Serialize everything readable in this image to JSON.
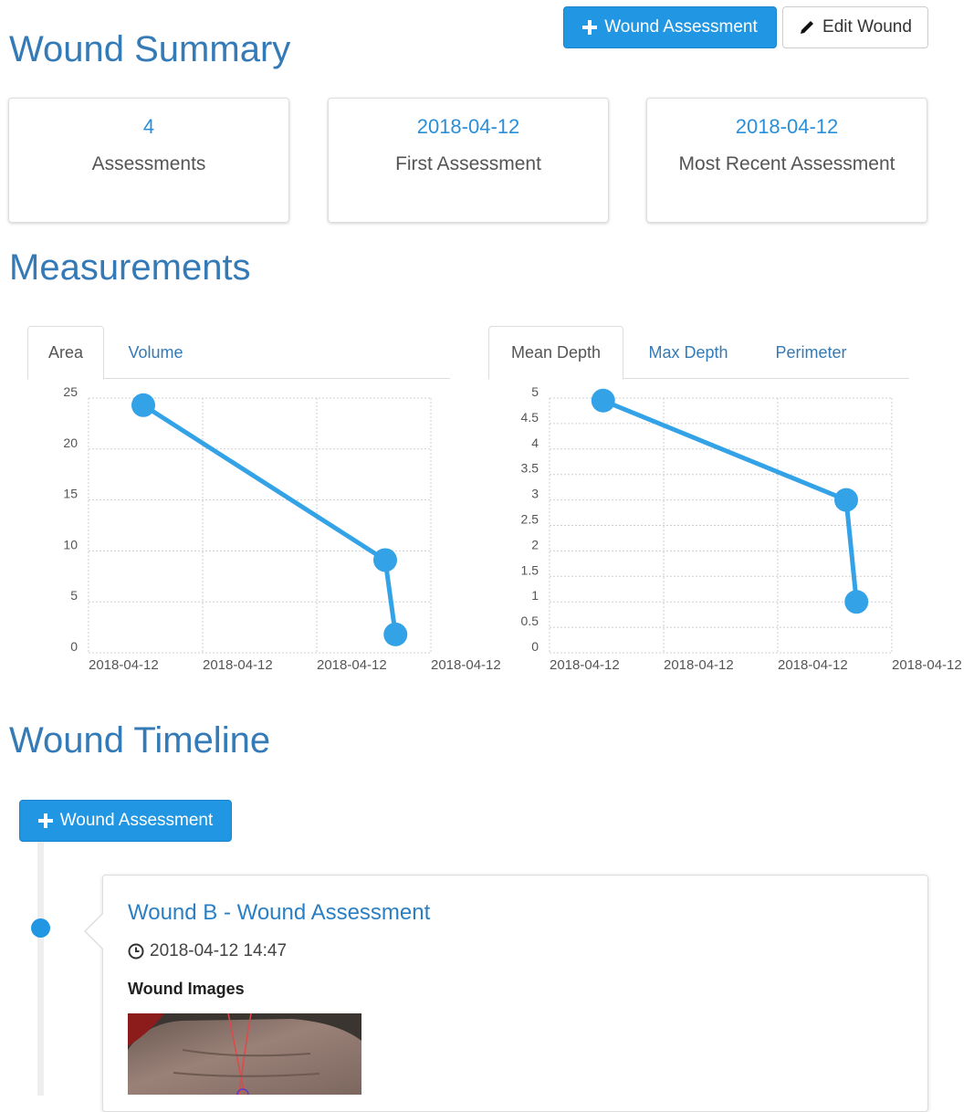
{
  "header": {
    "title": "Wound Summary",
    "add_assessment_label": "Wound Assessment",
    "edit_wound_label": "Edit Wound"
  },
  "summary_cards": [
    {
      "value": "4",
      "label": "Assessments"
    },
    {
      "value": "2018-04-12",
      "label": "First Assessment"
    },
    {
      "value": "2018-04-12",
      "label": "Most Recent Assessment"
    }
  ],
  "measurements": {
    "title": "Measurements",
    "left_tabs": [
      {
        "label": "Area",
        "active": true
      },
      {
        "label": "Volume",
        "active": false
      }
    ],
    "right_tabs": [
      {
        "label": "Mean Depth",
        "active": true
      },
      {
        "label": "Max Depth",
        "active": false
      },
      {
        "label": "Perimeter",
        "active": false
      }
    ]
  },
  "chart_data": [
    {
      "type": "line",
      "series": [
        {
          "name": "",
          "points": [
            [
              0.48,
              24.3
            ],
            [
              2.6,
              9.1
            ],
            [
              2.69,
              1.8
            ]
          ]
        }
      ],
      "xtick_labels": [
        "2018-04-12",
        "2018-04-12",
        "2018-04-12",
        "2018-04-12"
      ],
      "xlim": [
        0,
        3
      ],
      "ylim": [
        0,
        25
      ],
      "yticks": [
        "0",
        "5",
        "10",
        "15",
        "20",
        "25"
      ],
      "grid": true,
      "color": "#33a2e6"
    },
    {
      "type": "line",
      "series": [
        {
          "name": "",
          "points": [
            [
              0.47,
              4.95
            ],
            [
              2.6,
              3.0
            ],
            [
              2.69,
              1.0
            ]
          ]
        }
      ],
      "xtick_labels": [
        "2018-04-12",
        "2018-04-12",
        "2018-04-12",
        "2018-04-12"
      ],
      "xlim": [
        0,
        3
      ],
      "ylim": [
        0,
        5
      ],
      "yticks": [
        "0",
        "0.5",
        "1",
        "1.5",
        "2",
        "2.5",
        "3",
        "3.5",
        "4",
        "4.5",
        "5"
      ],
      "grid": true,
      "color": "#33a2e6"
    }
  ],
  "timeline": {
    "title": "Wound Timeline",
    "add_assessment_label": "Wound Assessment",
    "entries": [
      {
        "title": "Wound B - Wound Assessment",
        "timestamp": "2018-04-12 14:47",
        "images_label": "Wound Images"
      }
    ]
  }
}
